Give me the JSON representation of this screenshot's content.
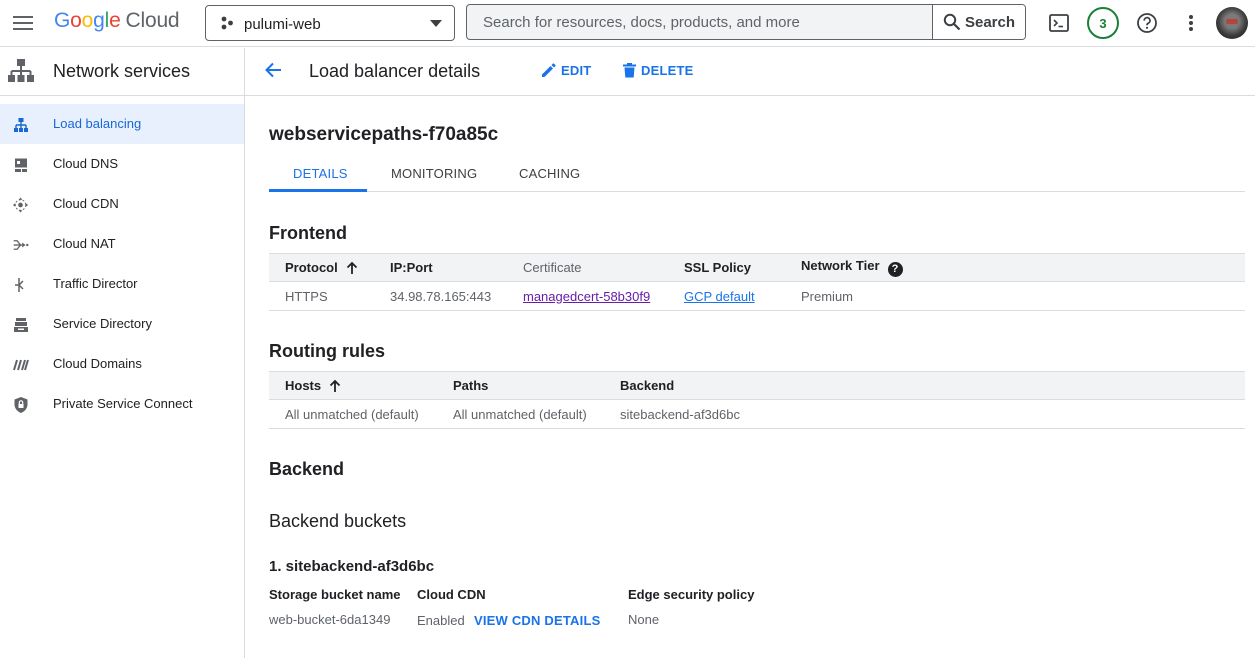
{
  "topbar": {
    "logo_google": [
      "G",
      "o",
      "o",
      "g",
      "l",
      "e"
    ],
    "logo_cloud": "Cloud",
    "project_name": "pulumi-web",
    "search_placeholder": "Search for resources, docs, products, and more",
    "search_button": "Search",
    "notifications_count": "3"
  },
  "sidebar": {
    "title": "Network services",
    "items": [
      {
        "label": "Load balancing",
        "icon": "load-balancing-icon",
        "active": true
      },
      {
        "label": "Cloud DNS",
        "icon": "cloud-dns-icon"
      },
      {
        "label": "Cloud CDN",
        "icon": "cloud-cdn-icon"
      },
      {
        "label": "Cloud NAT",
        "icon": "cloud-nat-icon"
      },
      {
        "label": "Traffic Director",
        "icon": "traffic-director-icon"
      },
      {
        "label": "Service Directory",
        "icon": "service-directory-icon"
      },
      {
        "label": "Cloud Domains",
        "icon": "cloud-domains-icon"
      },
      {
        "label": "Private Service Connect",
        "icon": "private-service-connect-icon"
      }
    ]
  },
  "header": {
    "title": "Load balancer details",
    "edit_label": "EDIT",
    "delete_label": "DELETE"
  },
  "lb_name": "webservicepaths-f70a85c",
  "tabs": [
    "DETAILS",
    "MONITORING",
    "CACHING"
  ],
  "frontend": {
    "heading": "Frontend",
    "columns": [
      "Protocol",
      "IP:Port",
      "Certificate",
      "SSL Policy",
      "Network Tier"
    ],
    "row": {
      "protocol": "HTTPS",
      "ip_port": "34.98.78.165:443",
      "certificate": "managedcert-58b30f9",
      "ssl_policy": "GCP default",
      "network_tier": "Premium"
    }
  },
  "routing": {
    "heading": "Routing rules",
    "columns": [
      "Hosts",
      "Paths",
      "Backend"
    ],
    "row": {
      "hosts": "All unmatched (default)",
      "paths": "All unmatched (default)",
      "backend": "sitebackend-af3d6bc"
    }
  },
  "backend": {
    "heading": "Backend",
    "buckets_heading": "Backend buckets",
    "bucket_title": "1. sitebackend-af3d6bc",
    "labels": {
      "storage": "Storage bucket name",
      "cdn": "Cloud CDN",
      "edge": "Edge security policy"
    },
    "values": {
      "storage": "web-bucket-6da1349",
      "cdn": "Enabled",
      "cdn_link": "VIEW CDN DETAILS",
      "edge": "None"
    }
  }
}
